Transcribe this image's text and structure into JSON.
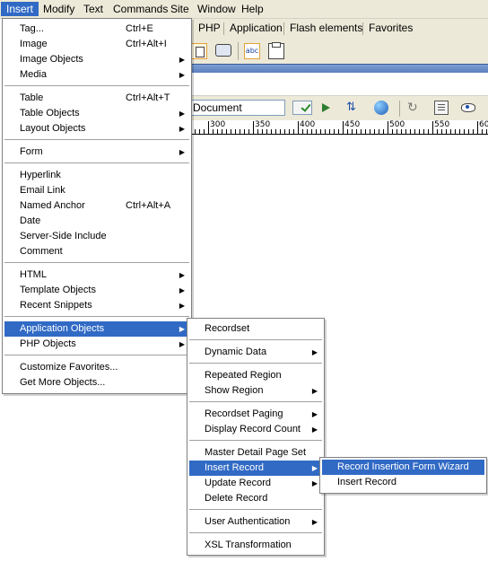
{
  "menubar": {
    "items": [
      "Insert",
      "Modify",
      "Text",
      "Commands",
      "Site",
      "Window",
      "Help"
    ],
    "active": "Insert"
  },
  "insert_bar": {
    "tabs": [
      "PHP",
      "Application",
      "Flash elements",
      "Favorites"
    ]
  },
  "document_toolbar": {
    "title_value": "Document"
  },
  "ruler": {
    "labels": [
      "300",
      "350",
      "400",
      "450",
      "500",
      "550",
      "60"
    ]
  },
  "insert_menu": {
    "items": [
      {
        "label": "Tag...",
        "shortcut": "Ctrl+E"
      },
      {
        "label": "Image",
        "shortcut": "Ctrl+Alt+I"
      },
      {
        "label": "Image Objects",
        "submenu": true
      },
      {
        "label": "Media",
        "submenu": true
      },
      {
        "label": "Table",
        "shortcut": "Ctrl+Alt+T"
      },
      {
        "label": "Table Objects",
        "submenu": true
      },
      {
        "label": "Layout Objects",
        "submenu": true
      },
      {
        "label": "Form",
        "submenu": true
      },
      {
        "label": "Hyperlink"
      },
      {
        "label": "Email Link"
      },
      {
        "label": "Named Anchor",
        "shortcut": "Ctrl+Alt+A"
      },
      {
        "label": "Date"
      },
      {
        "label": "Server-Side Include"
      },
      {
        "label": "Comment"
      },
      {
        "label": "HTML",
        "submenu": true
      },
      {
        "label": "Template Objects",
        "submenu": true
      },
      {
        "label": "Recent Snippets",
        "submenu": true
      },
      {
        "label": "Application Objects",
        "submenu": true,
        "highlighted": true
      },
      {
        "label": "PHP Objects",
        "submenu": true
      },
      {
        "label": "Customize Favorites..."
      },
      {
        "label": "Get More Objects..."
      }
    ]
  },
  "application_objects_menu": {
    "items": [
      {
        "label": "Recordset"
      },
      {
        "label": "Dynamic Data",
        "submenu": true
      },
      {
        "label": "Repeated Region"
      },
      {
        "label": "Show Region",
        "submenu": true
      },
      {
        "label": "Recordset Paging",
        "submenu": true
      },
      {
        "label": "Display Record Count",
        "submenu": true
      },
      {
        "label": "Master Detail Page Set"
      },
      {
        "label": "Insert Record",
        "submenu": true,
        "highlighted": true
      },
      {
        "label": "Update Record",
        "submenu": true
      },
      {
        "label": "Delete Record"
      },
      {
        "label": "User Authentication",
        "submenu": true
      },
      {
        "label": "XSL Transformation"
      }
    ]
  },
  "insert_record_menu": {
    "items": [
      {
        "label": "Record Insertion Form Wizard",
        "highlighted": true
      },
      {
        "label": "Insert Record"
      }
    ]
  },
  "icons": {
    "submenu_arrow": "▶",
    "toolbar": [
      "calendar-icon",
      "button-icon",
      "text-field-icon",
      "textarea-icon",
      "validate-icon",
      "debug-icon",
      "file-management-icon",
      "preview-icon",
      "refresh-icon",
      "view-options-icon",
      "visual-aids-icon"
    ]
  },
  "colors": {
    "menu_highlight": "#316ac5",
    "menubar_bg": "#ece9d8",
    "menu_bg": "#ffffff"
  }
}
